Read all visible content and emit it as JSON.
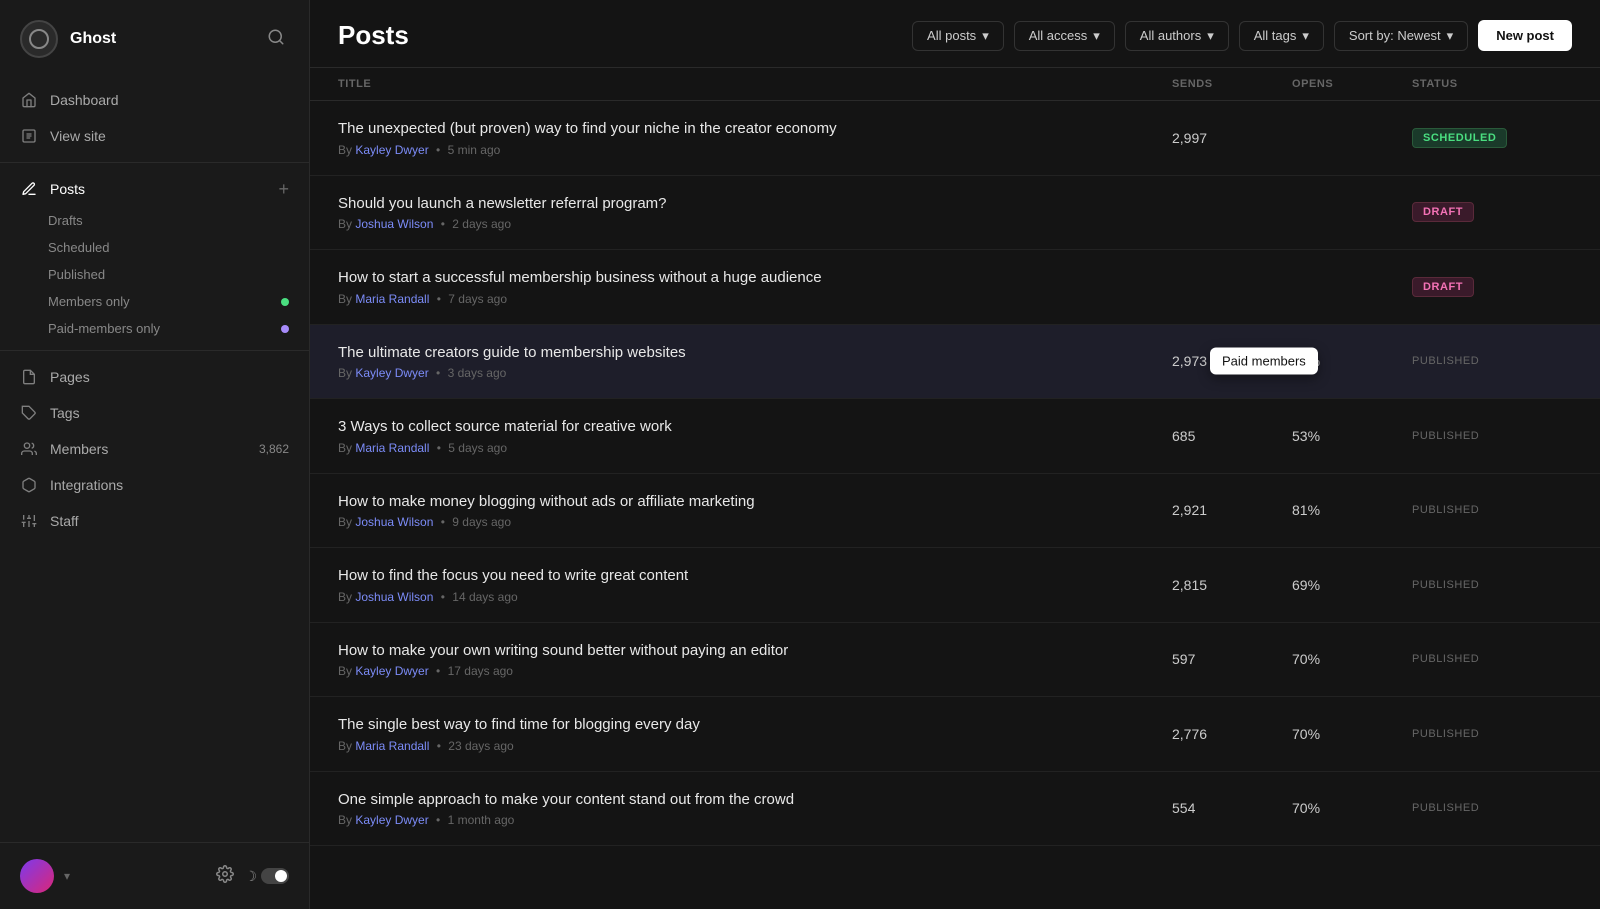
{
  "sidebar": {
    "site_name": "Ghost",
    "nav_items": [
      {
        "id": "dashboard",
        "label": "Dashboard",
        "icon": "home"
      },
      {
        "id": "view-site",
        "label": "View site",
        "icon": "external-link"
      }
    ],
    "posts_label": "Posts",
    "sub_nav": [
      {
        "id": "drafts",
        "label": "Drafts",
        "dot_color": null
      },
      {
        "id": "scheduled",
        "label": "Scheduled",
        "dot_color": null
      },
      {
        "id": "published",
        "label": "Published",
        "dot_color": null
      },
      {
        "id": "members-only",
        "label": "Members only",
        "dot_color": "#4ade80"
      },
      {
        "id": "paid-members-only",
        "label": "Paid-members only",
        "dot_color": "#a78bfa"
      }
    ],
    "more_nav": [
      {
        "id": "pages",
        "label": "Pages",
        "icon": "file"
      },
      {
        "id": "tags",
        "label": "Tags",
        "icon": "tag"
      },
      {
        "id": "members",
        "label": "Members",
        "icon": "users",
        "badge": "3,862"
      },
      {
        "id": "integrations",
        "label": "Integrations",
        "icon": "box"
      },
      {
        "id": "staff",
        "label": "Staff",
        "icon": "users-cog"
      }
    ]
  },
  "header": {
    "title": "Posts",
    "filters": [
      {
        "id": "all-posts",
        "label": "All posts"
      },
      {
        "id": "all-access",
        "label": "All access"
      },
      {
        "id": "all-authors",
        "label": "All authors"
      },
      {
        "id": "all-tags",
        "label": "All tags"
      },
      {
        "id": "sort",
        "label": "Sort by: Newest"
      }
    ],
    "new_post_label": "New post"
  },
  "table": {
    "columns": [
      {
        "id": "title",
        "label": "TITLE"
      },
      {
        "id": "sends",
        "label": "SENDS"
      },
      {
        "id": "opens",
        "label": "OPENS"
      },
      {
        "id": "status",
        "label": "STATUS"
      }
    ],
    "rows": [
      {
        "id": "row-1",
        "title": "The unexpected (but proven) way to find your niche in the creator economy",
        "author": "Kayley Dwyer",
        "time": "5 min ago",
        "sends": "2,997",
        "opens": "",
        "status": "SCHEDULED",
        "status_type": "scheduled"
      },
      {
        "id": "row-2",
        "title": "Should you launch a newsletter referral program?",
        "author": "Joshua Wilson",
        "time": "2 days ago",
        "sends": "",
        "opens": "",
        "status": "DRAFT",
        "status_type": "draft"
      },
      {
        "id": "row-3",
        "title": "How to start a successful membership business without a huge audience",
        "author": "Maria Randall",
        "time": "7 days ago",
        "sends": "",
        "opens": "",
        "status": "DRAFT",
        "status_type": "draft"
      },
      {
        "id": "row-4",
        "title": "The ultimate creators guide to membership websites",
        "author": "Kayley Dwyer",
        "time": "3 days ago",
        "sends": "2,973",
        "opens": "72%",
        "status": "PUBLISHED",
        "status_type": "published",
        "highlighted": true,
        "tooltip": "Paid members"
      },
      {
        "id": "row-5",
        "title": "3 Ways to collect source material for creative work",
        "author": "Maria Randall",
        "time": "5 days ago",
        "sends": "685",
        "opens": "53%",
        "status": "PUBLISHED",
        "status_type": "published"
      },
      {
        "id": "row-6",
        "title": "How to make money blogging without ads or affiliate marketing",
        "author": "Joshua Wilson",
        "time": "9 days ago",
        "sends": "2,921",
        "opens": "81%",
        "status": "PUBLISHED",
        "status_type": "published"
      },
      {
        "id": "row-7",
        "title": "How to find the focus you need to write great content",
        "author": "Joshua Wilson",
        "time": "14 days ago",
        "sends": "2,815",
        "opens": "69%",
        "status": "PUBLISHED",
        "status_type": "published"
      },
      {
        "id": "row-8",
        "title": "How to make your own writing sound better without paying an editor",
        "author": "Kayley Dwyer",
        "time": "17 days ago",
        "sends": "597",
        "opens": "70%",
        "status": "PUBLISHED",
        "status_type": "published"
      },
      {
        "id": "row-9",
        "title": "The single best way to find time for blogging every day",
        "author": "Maria Randall",
        "time": "23 days ago",
        "sends": "2,776",
        "opens": "70%",
        "status": "PUBLISHED",
        "status_type": "published"
      },
      {
        "id": "row-10",
        "title": "One simple approach to make your content stand out from the crowd",
        "author": "Kayley Dwyer",
        "time": "1 month ago",
        "sends": "554",
        "opens": "70%",
        "status": "PUBLISHED",
        "status_type": "published"
      }
    ]
  }
}
